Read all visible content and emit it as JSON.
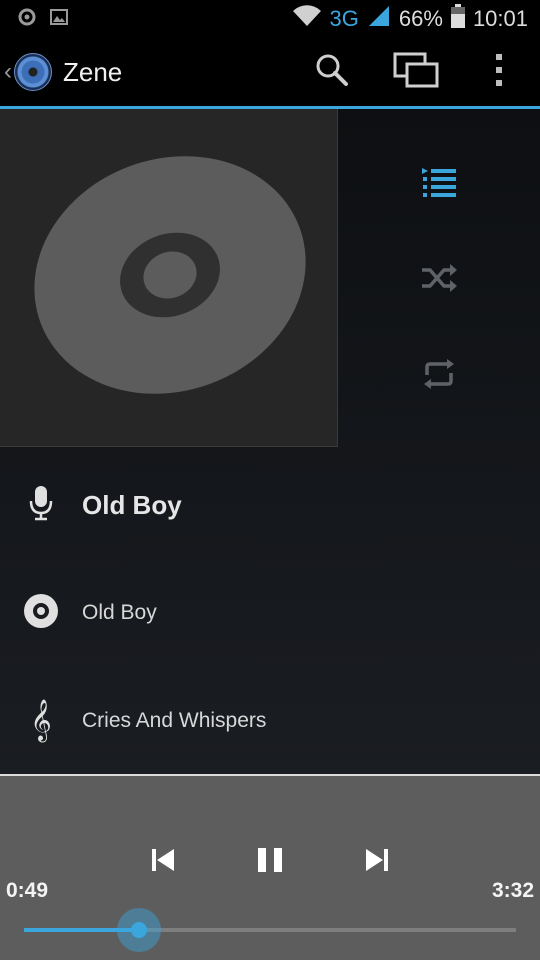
{
  "status_bar": {
    "network_type": "3G",
    "battery_percent": "66%",
    "time": "10:01",
    "icons": [
      "settings-notification-icon",
      "image-notification-icon",
      "wifi-icon",
      "signal-icon",
      "battery-icon"
    ],
    "battery_level": 0.66
  },
  "action_bar": {
    "title": "Zene",
    "actions": [
      "search-icon",
      "cast-icon",
      "overflow-menu-icon"
    ]
  },
  "side_actions": [
    "queue-list-icon",
    "shuffle-icon",
    "repeat-icon"
  ],
  "track": {
    "artist": "Old Boy",
    "album": "Old Boy",
    "song": "Cries And Whispers"
  },
  "player": {
    "elapsed": "0:49",
    "duration": "3:32",
    "progress": 0.234,
    "state": "playing"
  },
  "colors": {
    "accent": "#3ba6de",
    "player_bg": "#5d5d5d",
    "status_bg": "#000000"
  }
}
